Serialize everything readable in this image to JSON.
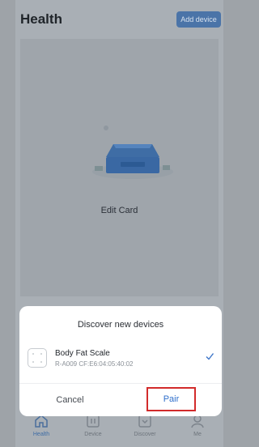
{
  "header": {
    "title": "Health",
    "add_device_label": "Add device"
  },
  "card": {
    "label": "Edit Card"
  },
  "dialog": {
    "title": "Discover new devices",
    "device": {
      "name": "Body Fat Scale",
      "id": "R-A009 CF:E6:04:05:40:02"
    },
    "cancel_label": "Cancel",
    "pair_label": "Pair"
  },
  "tabs": [
    {
      "label": "Health",
      "icon": "home-icon",
      "active": true
    },
    {
      "label": "Device",
      "icon": "device-icon",
      "active": false
    },
    {
      "label": "Discover",
      "icon": "discover-icon",
      "active": false
    },
    {
      "label": "Me",
      "icon": "profile-icon",
      "active": false
    }
  ],
  "colors": {
    "accent": "#4b74a8",
    "pair_text": "#2f6fcb",
    "highlight_border": "#d22b2b"
  }
}
